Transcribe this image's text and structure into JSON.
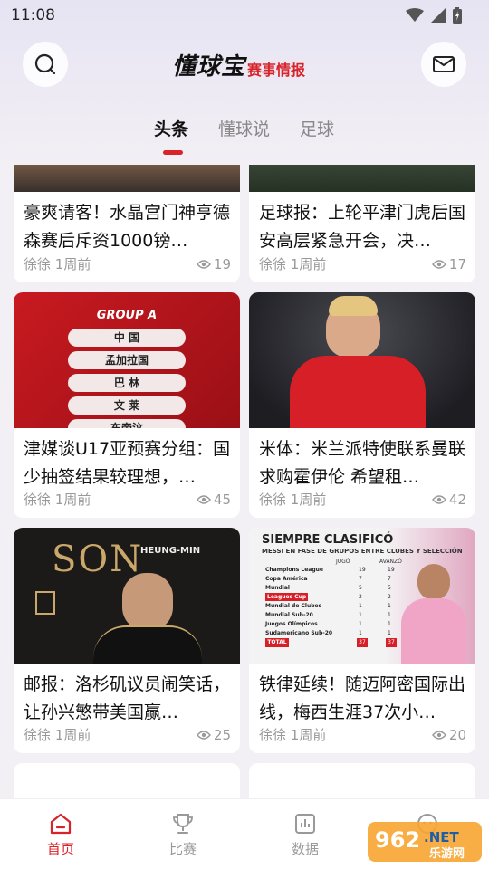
{
  "status_bar": {
    "time": "11:08"
  },
  "header": {
    "logo_main": "懂球宝",
    "logo_sub": "赛事情报"
  },
  "tabs": [
    {
      "label": "头条",
      "active": true
    },
    {
      "label": "懂球说",
      "active": false
    },
    {
      "label": "足球",
      "active": false
    }
  ],
  "cards": [
    {
      "title": "豪爽请客！水晶宫门神亨德森赛后斥资1000镑…",
      "author": "徐徐",
      "time": "1周前",
      "views": "19"
    },
    {
      "title": "足球报：上轮平津门虎后国安高层紧急开会，决…",
      "author": "徐徐",
      "time": "1周前",
      "views": "17"
    },
    {
      "title": "津媒谈U17亚预赛分组：国少抽签结果较理想，…",
      "author": "徐徐",
      "time": "1周前",
      "views": "45"
    },
    {
      "title": "米体：米兰派特使联系曼联求购霍伊伦 希望租…",
      "author": "徐徐",
      "time": "1周前",
      "views": "42"
    },
    {
      "title": "邮报：洛杉矶议员闹笑话，让孙兴慜带美国赢…",
      "author": "徐徐",
      "time": "1周前",
      "views": "25"
    },
    {
      "title": "铁律延续！随迈阿密国际出线，梅西生涯37次小…",
      "author": "徐徐",
      "time": "1周前",
      "views": "20"
    }
  ],
  "group_image": {
    "heading": "GROUP A",
    "teams": [
      "中 国",
      "孟加拉国",
      "巴 林",
      "文 莱",
      "东帝汶"
    ]
  },
  "son_image": {
    "name": "SON",
    "sub": "HEUNG-MIN"
  },
  "messi_image": {
    "title": "SIEMPRE CLASIFICÓ",
    "subtitle": "MESSI EN FASE DE GRUPOS ENTRE CLUBES Y SELECCIÓN",
    "col1": "JUGÓ",
    "col2": "AVANZÓ",
    "rows": [
      {
        "name": "Champions League",
        "a": "19",
        "b": "19"
      },
      {
        "name": "Copa América",
        "a": "7",
        "b": "7"
      },
      {
        "name": "Mundial",
        "a": "5",
        "b": "5"
      },
      {
        "name": "Leagues Cup",
        "a": "2",
        "b": "2"
      },
      {
        "name": "Mundial de Clubes",
        "a": "1",
        "b": "1"
      },
      {
        "name": "Mundial Sub-20",
        "a": "1",
        "b": "1"
      },
      {
        "name": "Juegos Olímpicos",
        "a": "1",
        "b": "1"
      },
      {
        "name": "Sudamericano Sub-20",
        "a": "1",
        "b": "1"
      }
    ],
    "total_label": "TOTAL",
    "total_a": "37",
    "total_b": "37"
  },
  "bottom_nav": [
    {
      "label": "首页",
      "icon": "home-icon",
      "active": true
    },
    {
      "label": "比赛",
      "icon": "trophy-icon",
      "active": false
    },
    {
      "label": "数据",
      "icon": "chart-icon",
      "active": false
    },
    {
      "label": "",
      "icon": "profile-icon",
      "active": false
    }
  ],
  "watermark": {
    "text1": "962",
    "text2": ".NET",
    "text3": "乐游网"
  },
  "colors": {
    "accent": "#d8232a",
    "bg": "#f3f0f5"
  }
}
